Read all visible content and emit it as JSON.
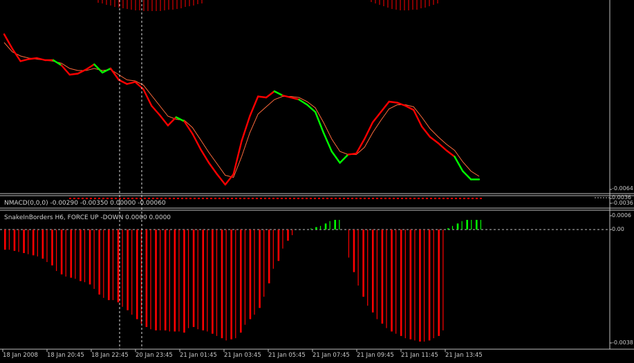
{
  "panels": {
    "nmacd": {
      "label": "NMACD(0,0,0) -0.00290 -0.00350 0.00000 -0.00060",
      "price_labels": [
        "0.0036",
        "-0.0036"
      ]
    },
    "snake": {
      "label": "SnakeInBorders H6, FORCE UP -DOWN  0.0000 0.0000",
      "price_labels": [
        "0.0006",
        "0.00",
        "-0.0038"
      ]
    },
    "main": {
      "price_labels": [
        "-0.0064",
        "-0.0036"
      ]
    }
  },
  "time_axis": [
    "18 Jan 2008",
    "18 Jan 20:45",
    "18 Jan 22:45",
    "20 Jan 23:45",
    "21 Jan 01:45",
    "21 Jan 03:45",
    "21 Jan 05:45",
    "21 Jan 07:45",
    "21 Jan 09:45",
    "21 Jan 11:45",
    "21 Jan 13:45"
  ],
  "colors": {
    "background": "#000000",
    "up": "#00ff00",
    "down": "#ff0000",
    "grid": "#c0c0c0",
    "axis_text": "#c8c8c8"
  },
  "chart_data": [
    {
      "type": "line",
      "panel": "main",
      "series": [
        {
          "role": "fast line",
          "values": [
            25,
            39,
            51,
            49,
            48,
            50,
            50,
            55,
            64,
            63,
            59,
            54,
            62,
            58,
            69,
            73,
            71,
            78,
            94,
            103,
            113,
            105,
            109,
            121,
            136,
            149,
            160,
            170,
            160,
            128,
            104,
            85,
            86,
            80,
            84,
            86,
            88,
            93,
            100,
            120,
            138,
            149,
            141,
            140,
            126,
            110,
            100,
            90,
            91,
            94,
            98,
            114,
            124,
            130,
            137,
            143,
            157,
            165,
            165
          ],
          "segment_colors": [
            "down",
            "down",
            "down",
            "down",
            "down",
            "down",
            "up",
            "down",
            "down",
            "down",
            "down",
            "up",
            "up",
            "down",
            "down",
            "down",
            "down",
            "down",
            "down",
            "down",
            "down",
            "up",
            "down",
            "down",
            "down",
            "down",
            "down",
            "down",
            "down",
            "down",
            "down",
            "down",
            "down",
            "up",
            "down",
            "down",
            "up",
            "up",
            "up",
            "up",
            "up",
            "up",
            "down",
            "down",
            "down",
            "down",
            "down",
            "down",
            "down",
            "down",
            "down",
            "down",
            "down",
            "down",
            "down",
            "up",
            "up",
            "up",
            "up"
          ]
        },
        {
          "role": "slow line",
          "values": [
            33,
            42,
            46,
            48,
            49,
            50,
            51,
            53,
            58,
            60,
            60,
            58,
            60,
            59,
            64,
            69,
            70,
            74,
            84,
            94,
            104,
            107,
            108,
            115,
            127,
            139,
            150,
            161,
            163,
            143,
            120,
            102,
            95,
            88,
            85,
            85,
            86,
            90,
            96,
            110,
            126,
            138,
            141,
            141,
            134,
            120,
            108,
            97,
            93,
            93,
            95,
            105,
            116,
            124,
            131,
            137,
            148,
            157,
            162
          ]
        }
      ]
    },
    {
      "type": "bar",
      "panel": "SnakeInBorders H6, FORCE UP -DOWN",
      "series": [
        {
          "values": [
            -18,
            -18,
            -19,
            -20,
            -21,
            -22,
            -23,
            -24,
            -26,
            -29,
            -32,
            -37,
            -40,
            -42,
            -43,
            -44,
            -46,
            -47,
            -49,
            -53,
            -58,
            -61,
            -63,
            -63,
            -65,
            -69,
            -72,
            -76,
            -80,
            -84,
            -87,
            -89,
            -90,
            -90,
            -90,
            -91,
            -91,
            -91,
            -92,
            -88,
            -87,
            -89,
            -90,
            -91,
            -93,
            -95,
            -97,
            -99,
            -98,
            -97,
            -92,
            -85,
            -80,
            -76,
            -70,
            -60,
            -48,
            -35,
            -28,
            -17,
            -10,
            -5,
            0,
            0,
            0,
            1,
            2,
            3,
            5,
            7,
            8,
            8,
            0,
            -25,
            -38,
            -50,
            -60,
            -68,
            -74,
            -80,
            -84,
            -88,
            -91,
            -93,
            -95,
            -97,
            -98,
            -99,
            -100,
            -100,
            -99,
            -97,
            -95,
            -90,
            1,
            3,
            5,
            7,
            8,
            8,
            8,
            8
          ]
        }
      ]
    }
  ]
}
